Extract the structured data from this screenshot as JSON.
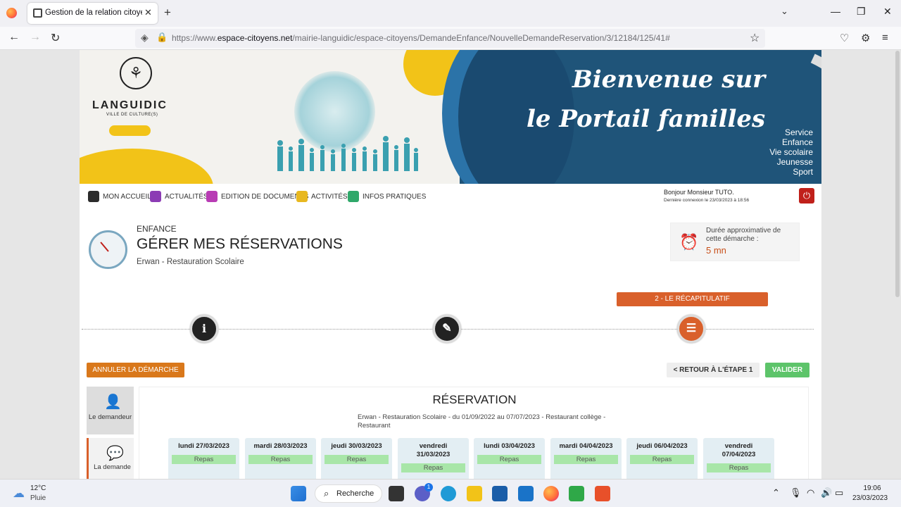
{
  "browser": {
    "tab_title": "Gestion de la relation citoyen d",
    "url_prefix": "https://www.",
    "url_domain": "espace-citoyens.net",
    "url_rest": "/mairie-languidic/espace-citoyens/DemandeEnfance/NouvelleDemandeReservation/3/12184/125/41#",
    "icons": {
      "new_tab": "+",
      "close": "✕",
      "back": "←",
      "forward": "→",
      "reload": "↻",
      "star": "☆",
      "pocket": "♡",
      "extensions": "⚙",
      "menu": "≡",
      "minimize": "—",
      "maximize": "❐",
      "window_close": "✕",
      "list_tabs": "⌄",
      "shield": "◈",
      "lock": "🔒"
    }
  },
  "banner": {
    "logo_text": "LANGUIDIC",
    "logo_sub": "VILLE DE CULTURE(S)",
    "welcome_line1": "Bienvenue sur",
    "welcome_line2": "le Portail familles",
    "services": [
      "Service",
      "Enfance",
      "Vie scolaire",
      "Jeunesse",
      "Sport"
    ]
  },
  "menu": {
    "items": [
      {
        "label": "MON ACCUEIL",
        "color": "#2b2b2b"
      },
      {
        "label": "ACTUALITÉS",
        "color": "#8c3cb4"
      },
      {
        "label": "EDITION DE DOCUMENTS",
        "color": "#b83cb4"
      },
      {
        "label": "ACTIVITÉS",
        "color": "#e8b820"
      },
      {
        "label": "INFOS PRATIQUES",
        "color": "#2fa86a"
      }
    ],
    "greeting": "Bonjour Monsieur TUTO.",
    "last_connection": "Dernière connexion le 23/03/2023 à 18:56",
    "power_icon": "⏻"
  },
  "header": {
    "section": "ENFANCE",
    "title": "GÉRER MES RÉSERVATIONS",
    "subtitle": "Erwan - Restauration Scolaire",
    "duration_label": "Durée approximative de cette démarche :",
    "duration_value": "5 mn",
    "alarm_icon": "⏰"
  },
  "steps": {
    "active_label": "2 - LE RÉCAPITULATIF",
    "icons": [
      "i",
      "✎",
      "☰"
    ]
  },
  "actions": {
    "cancel": "ANNULER LA DÉMARCHE",
    "back": "< RETOUR À L'ÉTAPE 1",
    "validate": "VALIDER"
  },
  "side": {
    "requester": "Le demandeur",
    "request": "La demande",
    "person_icon": "👤",
    "chat_icon": "💬"
  },
  "reservation": {
    "title": "RÉSERVATION",
    "description": "Erwan - Restauration Scolaire - du 01/09/2022 au 07/07/2023 - Restaurant collège - Restaurant",
    "days": [
      {
        "label": "lundi 27/03/2023",
        "meal": "Repas"
      },
      {
        "label": "mardi 28/03/2023",
        "meal": "Repas"
      },
      {
        "label": "jeudi 30/03/2023",
        "meal": "Repas"
      },
      {
        "label": "vendredi 31/03/2023",
        "meal": "Repas"
      },
      {
        "label": "lundi 03/04/2023",
        "meal": "Repas"
      },
      {
        "label": "mardi 04/04/2023",
        "meal": "Repas"
      },
      {
        "label": "jeudi 06/04/2023",
        "meal": "Repas"
      },
      {
        "label": "vendredi 07/04/2023",
        "meal": "Repas"
      }
    ]
  },
  "taskbar": {
    "temperature": "12°C",
    "condition": "Pluie",
    "search": "Recherche",
    "time": "19:06",
    "date": "23/03/2023",
    "badge": "1"
  }
}
